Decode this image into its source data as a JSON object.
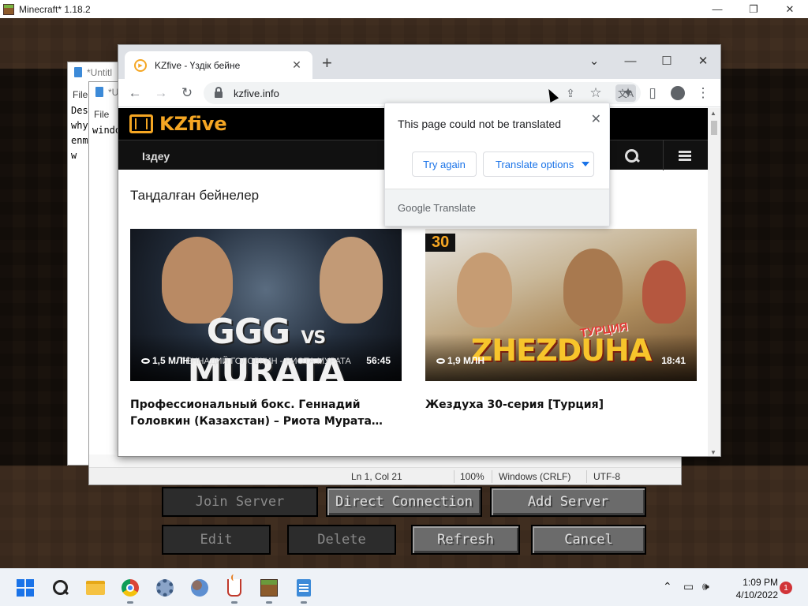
{
  "minecraft": {
    "window_title": "Minecraft* 1.18.2",
    "controls": {
      "minimize": "—",
      "maximize": "❐",
      "close": "✕"
    },
    "buttons": {
      "join_server": "Join Server",
      "direct_connection": "Direct Connection",
      "add_server": "Add Server",
      "edit": "Edit",
      "delete": "Delete",
      "refresh": "Refresh",
      "cancel": "Cancel"
    }
  },
  "notepad_back": {
    "title": "*Untitl",
    "menu": "File",
    "lines": [
      "Des",
      "why",
      "enm",
      "w"
    ]
  },
  "notepad_front": {
    "title": "*U",
    "menu": "File",
    "lines": [
      "windo"
    ],
    "status": {
      "position": "Ln 1, Col 21",
      "zoom": "100%",
      "line_ending": "Windows (CRLF)",
      "encoding": "UTF-8"
    }
  },
  "chrome": {
    "tab": {
      "title": "KZfive - Үздік бейне",
      "favicon": "play-icon",
      "close": "✕"
    },
    "new_tab": "+",
    "window_controls": {
      "tab_search": "⌄",
      "minimize": "—",
      "maximize": "☐",
      "close": "✕"
    },
    "toolbar": {
      "back": "←",
      "forward": "→",
      "reload": "↻",
      "share": "⇪",
      "star": "☆",
      "extensions": "✦",
      "side_panel": "▯",
      "menu": "⋮"
    },
    "url": "kzfive.info"
  },
  "site": {
    "logo": "KZfive",
    "nav_search_label": "Іздеу",
    "section_title": "Таңдалған бейнелер",
    "videos": [
      {
        "thumb_title_left": "GGG",
        "thumb_title_vs": "VS",
        "thumb_title_right": "MURATA",
        "thumb_subtitle": "ГЕННАДИЙ ГОЛОВКИН - РИОТА МУРАТА",
        "views": "1,5 МЛН",
        "duration": "56:45",
        "title": "Профессиональный бокс. Геннадий Головкин (Казахстан) – Риота Мурата…"
      },
      {
        "thumb_badge": "30",
        "thumb_kicker": "ТУРЦИЯ",
        "thumb_title": "ZHEZDUHA",
        "views": "1,9 МЛН",
        "duration": "18:41",
        "title": "Жездуха 30-серия [Турция]"
      }
    ]
  },
  "translate_popup": {
    "message": "This page could not be translated",
    "close": "✕",
    "try_again": "Try again",
    "options": "Translate options",
    "footer": "Google Translate"
  },
  "taskbar": {
    "time": "1:09 PM",
    "date": "4/10/2022",
    "notifications": "1",
    "tray": {
      "chevron": "⌃",
      "network": "▭",
      "volume": "🕪"
    }
  },
  "colors": {
    "accent": "#f5a623",
    "link_blue": "#1a73e8",
    "site_header": "#000000"
  }
}
